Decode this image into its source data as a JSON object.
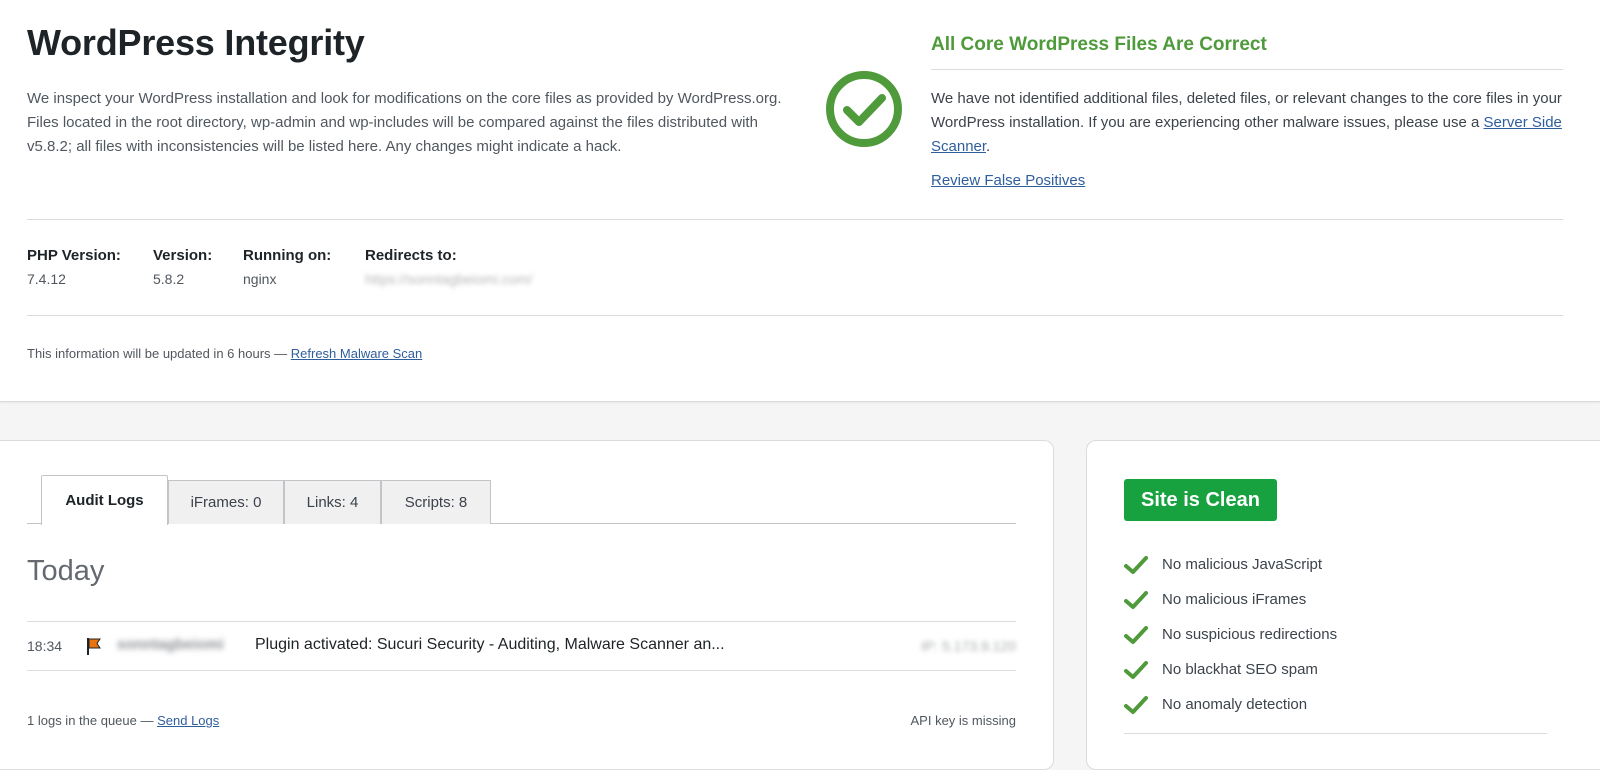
{
  "integrity": {
    "title": "WordPress Integrity",
    "intro": "We inspect your WordPress installation and look for modifications on the core files as provided by WordPress.org. Files located in the root directory, wp-admin and wp-includes will be compared against the files distributed with v5.8.2; all files with inconsistencies will be listed here. Any changes might indicate a hack.",
    "status_title": "All Core WordPress Files Are Correct",
    "status_text": "We have not identified additional files, deleted files, or relevant changes to the core files in your WordPress installation. If you are experiencing other malware issues, please use a",
    "status_link": "Server Side Scanner",
    "status_text_end": ".",
    "review_link": "Review False Positives",
    "status_color": "#4f9a3b"
  },
  "server_info": {
    "php_label": "PHP Version:",
    "php_value": "7.4.12",
    "version_label": "Version:",
    "version_value": "5.8.2",
    "running_label": "Running on:",
    "running_value": "nginx",
    "redirects_label": "Redirects to:",
    "redirects_value": "https://sonntagbeiomi.com/"
  },
  "update": {
    "text": "This information will be updated in 6 hours —",
    "link": "Refresh Malware Scan"
  },
  "audit": {
    "tabs": [
      {
        "label": "Audit Logs",
        "active": true
      },
      {
        "label": "iFrames: 0",
        "active": false
      },
      {
        "label": "Links: 4",
        "active": false
      },
      {
        "label": "Scripts: 8",
        "active": false
      }
    ],
    "day_heading": "Today",
    "logs": [
      {
        "time": "18:34",
        "icon": "flag-icon",
        "user": "sonntagbeiomi",
        "message": "Plugin activated: Sucuri Security - Auditing, Malware Scanner an...",
        "ip": "IP: 5.173.9.120"
      }
    ],
    "queue_text": "1 logs in the queue —",
    "queue_link": "Send Logs",
    "api_note": "API key is missing"
  },
  "clean": {
    "badge": "Site is Clean",
    "badge_color": "#17a23f",
    "check_color": "#4f9a3b",
    "checks": [
      "No malicious JavaScript",
      "No malicious iFrames",
      "No suspicious redirections",
      "No blackhat SEO spam",
      "No anomaly detection"
    ]
  }
}
